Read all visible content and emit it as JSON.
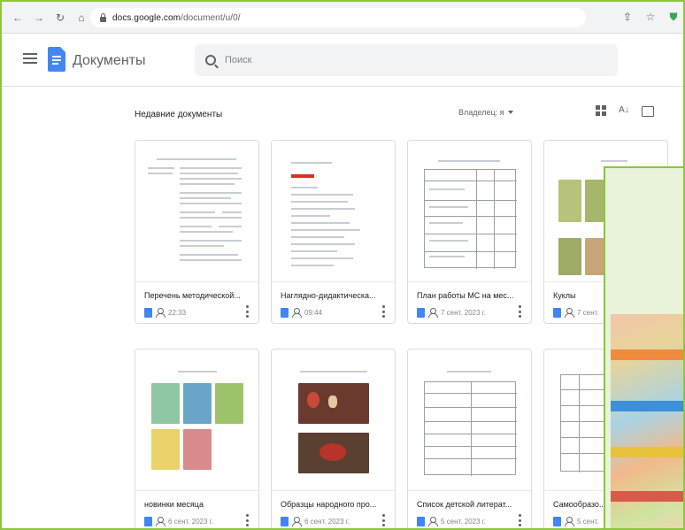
{
  "browser": {
    "url_host": "docs.google.com",
    "url_path": "/document/u/0/"
  },
  "app": {
    "title": "Документы",
    "search_placeholder": "Поиск"
  },
  "section": {
    "title": "Недавние документы",
    "owner_filter": "Владелец: я"
  },
  "documents": [
    {
      "title": "Перечень методической...",
      "date": "22:33"
    },
    {
      "title": "Наглядно-дидактическа...",
      "date": "09:44"
    },
    {
      "title": "План работы МС на мес...",
      "date": "7 сент. 2023 г."
    },
    {
      "title": "Куклы",
      "date": "7 сент."
    },
    {
      "title": "новинки месяца",
      "date": "6 сент. 2023 г."
    },
    {
      "title": "Образцы народного про...",
      "date": "6 сент. 2023 г."
    },
    {
      "title": "Список детской литерат...",
      "date": "5 сент. 2023 г."
    },
    {
      "title": "Самообразо...",
      "date": "5 сент."
    }
  ],
  "colors": {
    "frame_border": "#8cc63f",
    "docs_blue": "#4285f4",
    "accent_red": "#d93025"
  }
}
